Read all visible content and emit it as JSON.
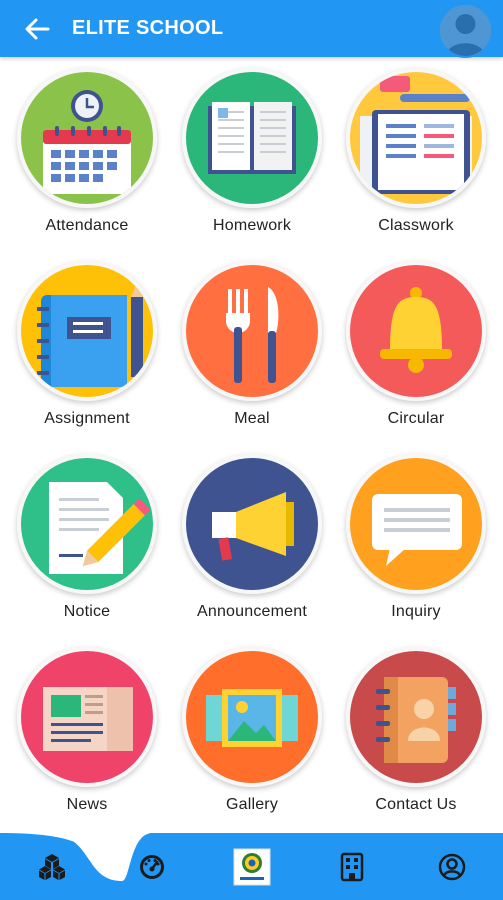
{
  "app_bar": {
    "title": "ELITE SCHOOL",
    "back_icon": "arrow-left-icon",
    "avatar_icon": "user-avatar-icon"
  },
  "menu": [
    {
      "label": "Attendance",
      "icon": "attendance-calendar-icon",
      "bg": "#8bc34a"
    },
    {
      "label": "Homework",
      "icon": "open-book-icon",
      "bg": "#2bb67a"
    },
    {
      "label": "Classwork",
      "icon": "notebook-icon",
      "bg": "#ffc83d"
    },
    {
      "label": "Assignment",
      "icon": "notepad-pencil-icon",
      "bg": "#ffc107"
    },
    {
      "label": "Meal",
      "icon": "fork-knife-icon",
      "bg": "#ff6f40"
    },
    {
      "label": "Circular",
      "icon": "bell-icon",
      "bg": "#f45a5a"
    },
    {
      "label": "Notice",
      "icon": "note-pencil-icon",
      "bg": "#2fbf88"
    },
    {
      "label": "Announcement",
      "icon": "megaphone-icon",
      "bg": "#3f5390"
    },
    {
      "label": "Inquiry",
      "icon": "chat-bubble-icon",
      "bg": "#ffa01f"
    },
    {
      "label": "News",
      "icon": "newspaper-icon",
      "bg": "#f0436a"
    },
    {
      "label": "Gallery",
      "icon": "picture-gallery-icon",
      "bg": "#ff6e2a"
    },
    {
      "label": "Contact Us",
      "icon": "address-book-icon",
      "bg": "#c94a4a"
    }
  ],
  "bottom_nav": [
    {
      "icon": "cubes-icon",
      "active": true
    },
    {
      "icon": "dashboard-gauge-icon",
      "active": false
    },
    {
      "icon": "school-logo-icon",
      "active": false
    },
    {
      "icon": "building-icon",
      "active": false
    },
    {
      "icon": "profile-icon",
      "active": false
    }
  ],
  "colors": {
    "primary": "#2196f3",
    "label_text": "#222222"
  }
}
